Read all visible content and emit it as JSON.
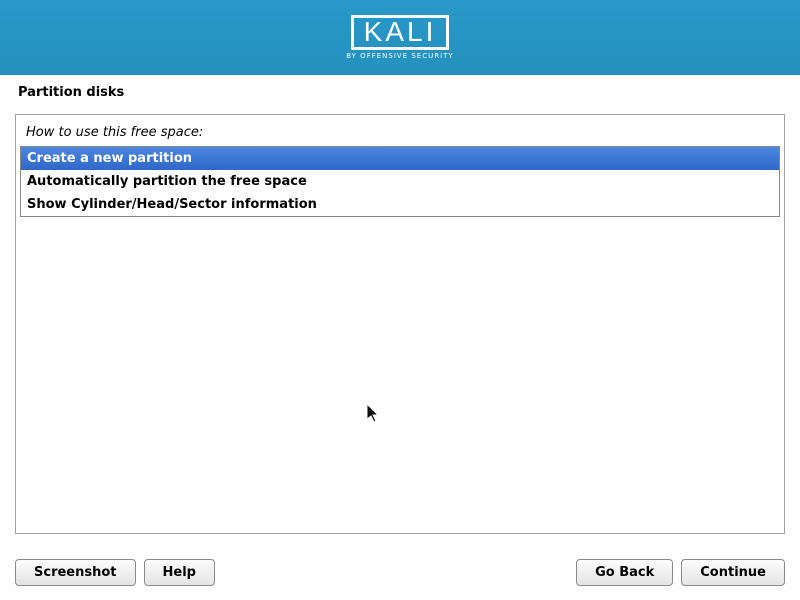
{
  "header": {
    "logo_text": "KALI",
    "logo_subtitle": "BY OFFENSIVE SECURITY"
  },
  "page": {
    "title": "Partition disks",
    "prompt": "How to use this free space:"
  },
  "options": [
    {
      "label": "Create a new partition",
      "selected": true
    },
    {
      "label": "Automatically partition the free space",
      "selected": false
    },
    {
      "label": "Show Cylinder/Head/Sector information",
      "selected": false
    }
  ],
  "buttons": {
    "screenshot": "Screenshot",
    "help": "Help",
    "go_back": "Go Back",
    "continue": "Continue"
  }
}
